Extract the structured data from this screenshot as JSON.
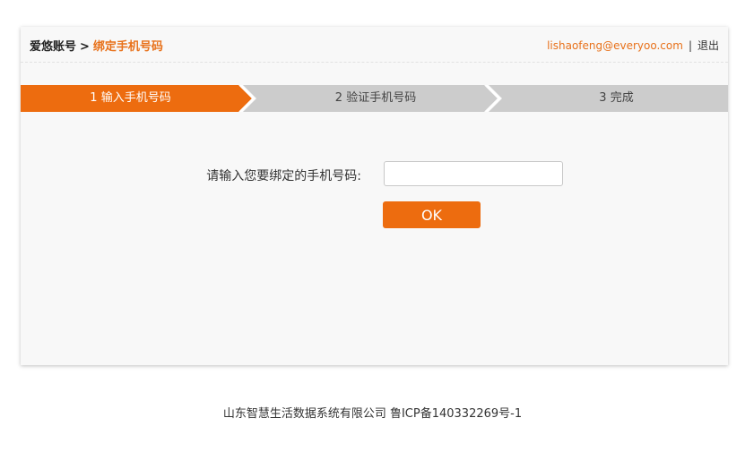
{
  "header": {
    "breadcrumb_root": "爱悠账号",
    "breadcrumb_separator": ">",
    "breadcrumb_current": "绑定手机号码",
    "user_email": "lishaofeng@everyoo.com",
    "user_separator": "|",
    "logout_label": "退出"
  },
  "steps": [
    {
      "label": "1 输入手机号码",
      "state": "active"
    },
    {
      "label": "2 验证手机号码",
      "state": "inactive"
    },
    {
      "label": "3 完成",
      "state": "inactive"
    }
  ],
  "form": {
    "phone_label": "请输入您要绑定的手机号码:",
    "phone_value": "",
    "ok_label": "OK"
  },
  "footer": {
    "text": "山东智慧生活数据系统有限公司 鲁ICP备140332269号-1"
  },
  "colors": {
    "accent": "#ed6c0f",
    "step_inactive": "#cccccc",
    "card_background": "#f8f8f8"
  }
}
